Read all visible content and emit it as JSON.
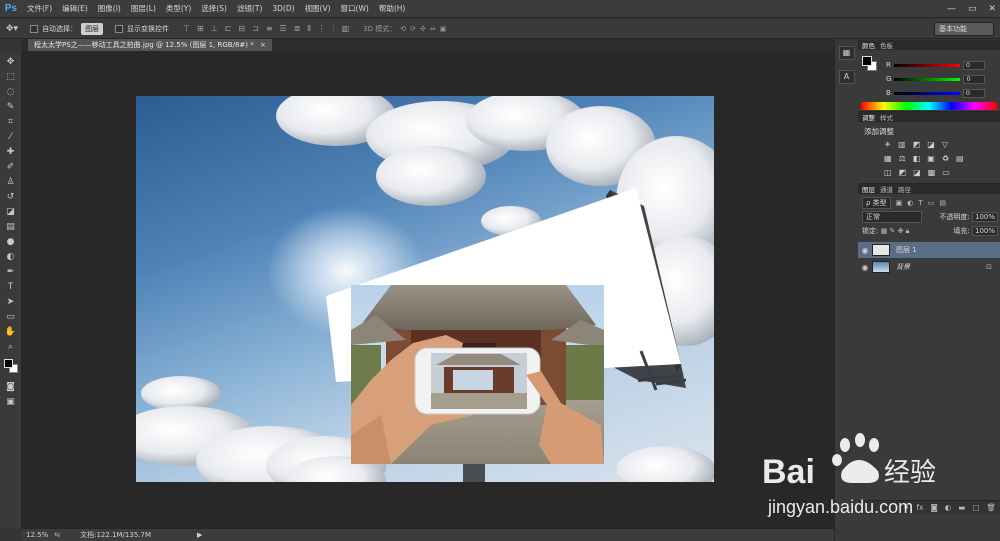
{
  "app": {
    "logo": "Ps",
    "menu": [
      "文件(F)",
      "编辑(E)",
      "图像(I)",
      "图层(L)",
      "类型(Y)",
      "选择(S)",
      "滤镜(T)",
      "3D(D)",
      "视图(V)",
      "窗口(W)",
      "帮助(H)"
    ]
  },
  "options": {
    "auto_select_label": "自动选择：",
    "auto_select_value": "图层",
    "show_transform_label": "显示变换控件",
    "mode_3d_label": "3D 模式：",
    "workspace": "基本功能"
  },
  "document": {
    "tab_title": "程太太学PS之——移动工具之拍曲.jpg @ 12.5% (图层 1, RGB/8#) *"
  },
  "status": {
    "zoom": "12.5%",
    "doc_info": "文档:122.1M/135.7M"
  },
  "panels": {
    "color_tabs": [
      "颜色",
      "色板"
    ],
    "r_label": "R",
    "g_label": "G",
    "b_label": "B",
    "r_value": "0",
    "g_value": "0",
    "b_value": "0",
    "adjust_tabs": [
      "调整",
      "样式"
    ],
    "adjust_title": "添加调整",
    "layers_tabs": [
      "图层",
      "通道",
      "路径"
    ],
    "kind_filter": "ρ 类型",
    "blend_mode": "正常",
    "opacity_label": "不透明度:",
    "opacity_value": "100%",
    "lock_label": "锁定:",
    "fill_label": "填充:",
    "fill_value": "100%",
    "layers": [
      {
        "name": "图层 1"
      },
      {
        "name": "背景"
      }
    ]
  },
  "watermark": {
    "brand": "Bai",
    "brand2": "经验",
    "url": "jingyan.baidu.com"
  },
  "colors": {
    "accent": "#4fa9ff",
    "selected_layer": "#5a6d86"
  }
}
